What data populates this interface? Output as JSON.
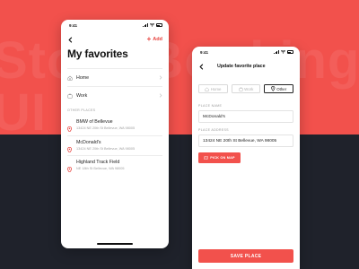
{
  "background": {
    "top_color": "#f2514c",
    "bottom_color": "#1f222b",
    "watermark_lines": [
      "Store Booking",
      "UI Kit"
    ]
  },
  "screen_list": {
    "status_time": "9:41",
    "back_icon": "chevron-left-icon",
    "add_label": "Add",
    "title": "My favorites",
    "favorites": [
      {
        "icon": "home-icon",
        "label": "Home"
      },
      {
        "icon": "briefcase-icon",
        "label": "Work"
      }
    ],
    "other_section_label": "OTHER PLACES",
    "other_places": [
      {
        "name": "BMW of Bellevue",
        "address": "13424 NE 20th St Bellevue, WA 98005"
      },
      {
        "name": "McDonald's",
        "address": "13424 NE 20th St Bellevue, WA 98005"
      },
      {
        "name": "Highland Track Field",
        "address": "NE 18th St Bellevue, WA 98005"
      }
    ]
  },
  "screen_edit": {
    "status_time": "9:41",
    "title": "Update favorite place",
    "segments": [
      {
        "icon": "home-icon",
        "label": "Home",
        "active": false
      },
      {
        "icon": "briefcase-icon",
        "label": "Work",
        "active": false
      },
      {
        "icon": "pin-icon",
        "label": "Other",
        "active": true
      }
    ],
    "place_name_label": "PLACE NAME",
    "place_name_value": "McDonald's",
    "place_address_label": "PLACE ADDRESS",
    "place_address_value": "13424 NE 20th St Bellevue, WA 98005",
    "pick_on_map_label": "PICK ON MAP",
    "save_label": "SAVE PLACE"
  },
  "accent_color": "#e8443f"
}
